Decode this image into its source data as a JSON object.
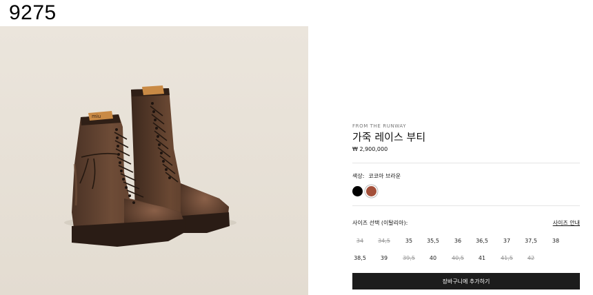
{
  "page": {
    "id_label": "9275"
  },
  "product": {
    "eyebrow": "FROM THE RUNWAY",
    "title": "가죽 레이스 부티",
    "price": "₩ 2,900,000",
    "image_alt": "brown leather lace-up combat boots"
  },
  "color": {
    "label": "색상:",
    "selected": "코코아 브라운",
    "swatches": [
      {
        "name": "black",
        "hex": "#000000"
      },
      {
        "name": "cocoa-brown",
        "hex": "#A4503A"
      }
    ]
  },
  "size": {
    "label": "사이즈 선택 (이탈리아):",
    "guide": "사이즈 안내",
    "rows": [
      [
        {
          "value": "34",
          "available": false
        },
        {
          "value": "34,5",
          "available": false
        },
        {
          "value": "35",
          "available": true
        },
        {
          "value": "35,5",
          "available": true
        },
        {
          "value": "36",
          "available": true
        },
        {
          "value": "36,5",
          "available": true
        },
        {
          "value": "37",
          "available": true
        },
        {
          "value": "37,5",
          "available": true
        },
        {
          "value": "38",
          "available": true
        }
      ],
      [
        {
          "value": "38,5",
          "available": true
        },
        {
          "value": "39",
          "available": true
        },
        {
          "value": "39,5",
          "available": false
        },
        {
          "value": "40",
          "available": true
        },
        {
          "value": "40,5",
          "available": false
        },
        {
          "value": "41",
          "available": true
        },
        {
          "value": "41,5",
          "available": false
        },
        {
          "value": "42",
          "available": false
        }
      ]
    ]
  },
  "cart": {
    "button": "장바구니에 추가하기"
  }
}
